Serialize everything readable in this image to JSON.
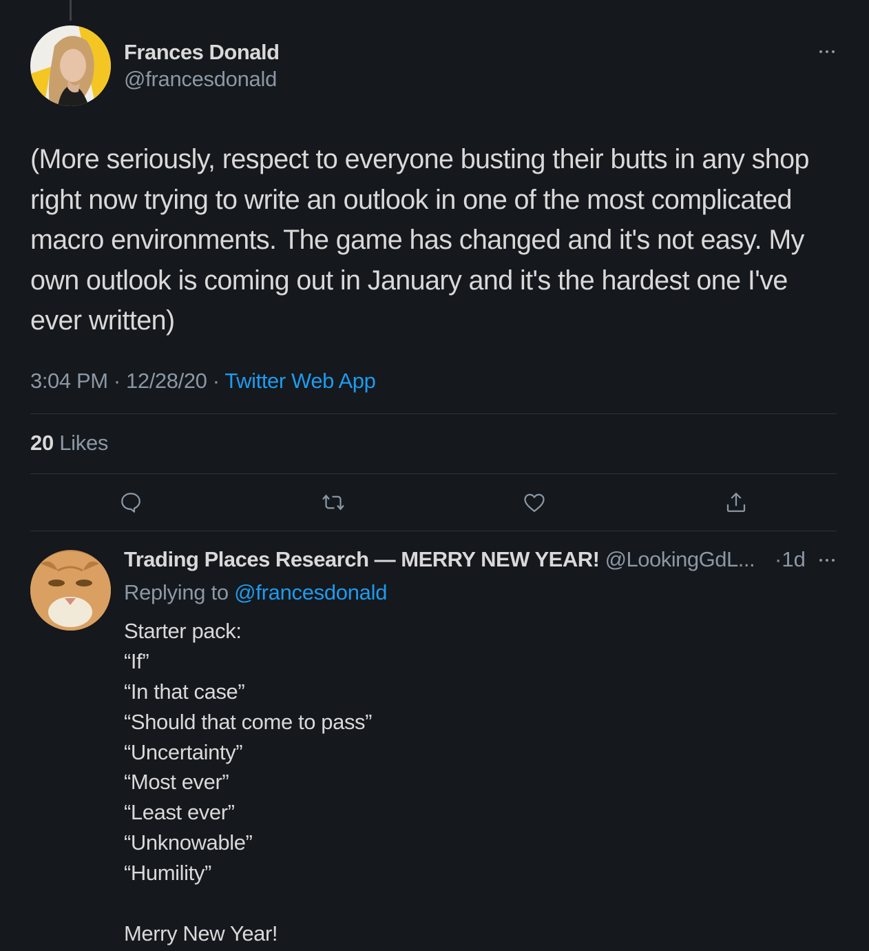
{
  "main_tweet": {
    "author_name": "Frances Donald",
    "author_handle": "@francesdonald",
    "text": "(More seriously, respect to everyone busting their butts in any shop right now trying to write an outlook in one of the most complicated macro environments. The game has changed and it's not easy. My own outlook is coming out in January and it's the hardest one I've ever written)",
    "time": "3:04 PM",
    "date": "12/28/20",
    "separator": "·",
    "source": "Twitter Web App",
    "likes_count": "20",
    "likes_label": "Likes",
    "more_icon": "more-dots-icon",
    "actions": [
      {
        "name": "reply",
        "icon": "reply-icon"
      },
      {
        "name": "retweet",
        "icon": "retweet-icon"
      },
      {
        "name": "like",
        "icon": "heart-icon"
      },
      {
        "name": "share",
        "icon": "share-icon"
      }
    ]
  },
  "reply_tweet": {
    "author_name": "Trading Places Research — MERRY NEW YEAR!",
    "author_handle": "@LookingGdL...",
    "time": "·1d",
    "replying_prefix": "Replying to",
    "replying_to": "@francesdonald",
    "lines": [
      "Starter pack:",
      "“If”",
      "“In that case”",
      "“Should that come to pass”",
      "“Uncertainty”",
      "“Most ever”",
      "“Least ever”",
      "“Unknowable”",
      "“Humility”",
      "",
      "Merry New Year!"
    ]
  },
  "colors": {
    "background": "#15181c",
    "text": "#d9d9d9",
    "secondary": "#8b98a5",
    "accent": "#1d9bf0",
    "divider": "#2f3336"
  }
}
